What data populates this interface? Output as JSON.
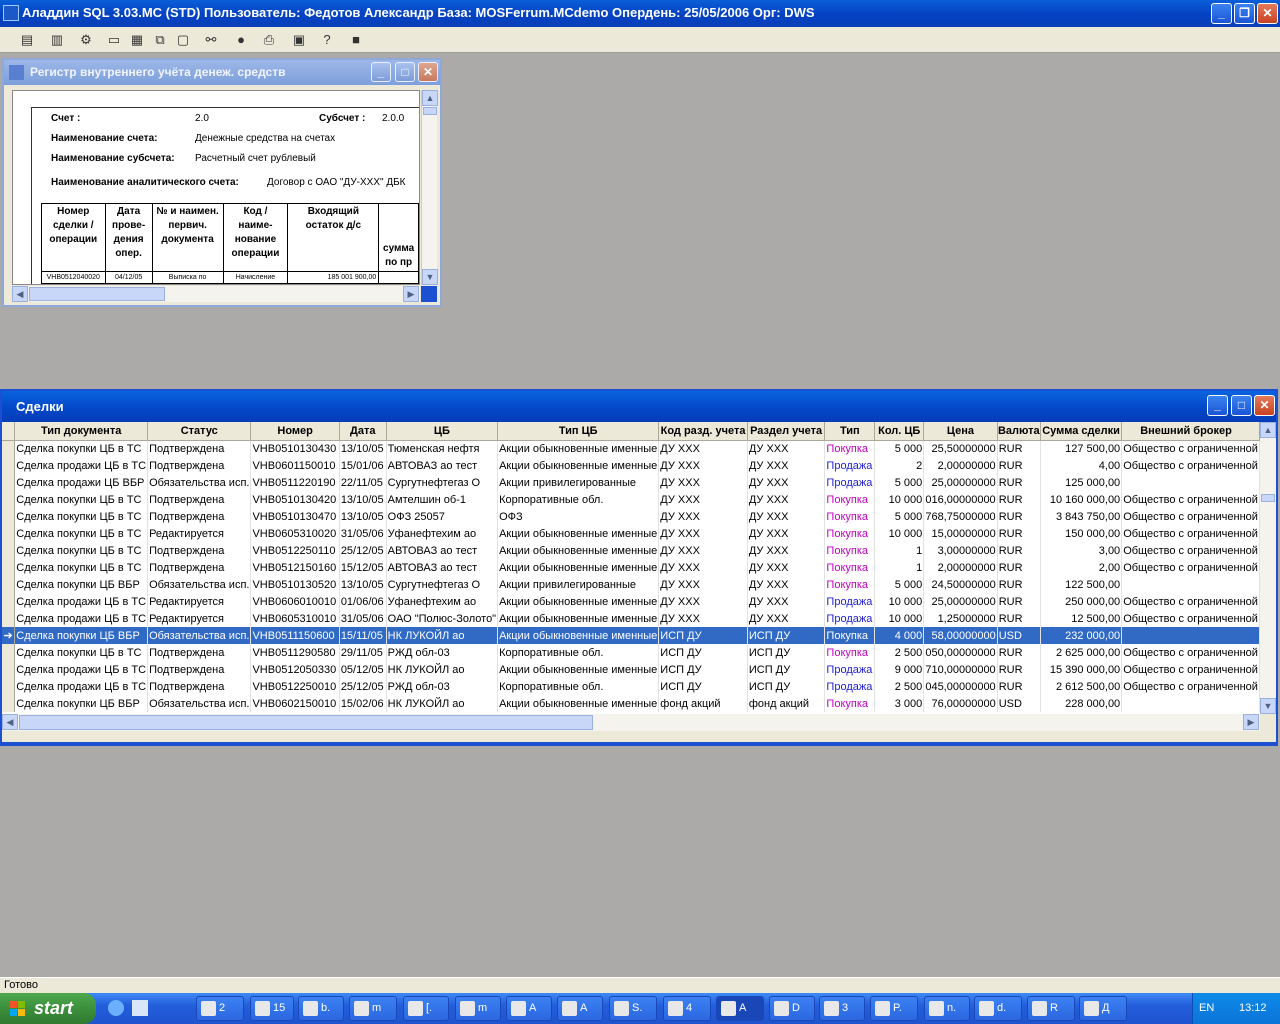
{
  "app": {
    "title": "Аладдин SQL 3.03.MC (STD)  Пользователь: Федотов Александр База: MOSFerrum.MCdemo Опердень: 25/05/2006 Орг: DWS"
  },
  "toolbar": {
    "icons": [
      "report-icon",
      "database-icon",
      "settings-icon",
      "window-icon",
      "tile-icon",
      "cascade-icon",
      "blank-icon",
      "binoculars-icon",
      "stop-icon",
      "print-icon",
      "export-icon",
      "help-icon",
      "exit-icon"
    ]
  },
  "register_window": {
    "title": "Регистр внутреннего учёта денеж. средств",
    "account_label": "Счет :",
    "account_value": "2.0",
    "subaccount_label": "Субсчет :",
    "subaccount_value": "2.0.0",
    "account_name_label": "Наименование счета:",
    "account_name_value": "Денежные средства на счетах",
    "subaccount_name_label": "Наименование субсчета:",
    "subaccount_name_value": "Расчетный счет рублевый",
    "analytic_label": "Наименование аналитического счета:",
    "analytic_value": "Договор с ОАО \"ДУ-XXX\" ДБК",
    "table_headers": [
      "Номер сделки / операции",
      "Дата прове- дения опер.",
      "№ и наимен. первич. документа",
      "Код / наиме- нование операции",
      "Входящий остаток д/с",
      "сумма по пр"
    ],
    "table_row": [
      "VHB0512040020",
      "04/12/05",
      "Выписка по",
      "Начисление",
      "185 001 900,00",
      ""
    ]
  },
  "deals_window": {
    "title": "Сделки",
    "columns": [
      "Тип документа",
      "Статус",
      "Номер",
      "Дата",
      "ЦБ",
      "Тип ЦБ",
      "Код разд. учета",
      "Раздел учета",
      "Тип",
      "Кол. ЦБ",
      "Цена",
      "Валюта",
      "Сумма сделки",
      "Внешний брокер"
    ],
    "rows": [
      {
        "doc": "Сделка покупки ЦБ в ТС",
        "status": "Подтверждена",
        "num": "VHB0510130430",
        "date": "13/10/05",
        "sec": "Тюменская нефтя",
        "sec_type": "Акции обыкновенные именные",
        "code": "ДУ XXX",
        "section": "ДУ XXX",
        "type": "Покупка",
        "qty": "5 000",
        "price": "25,50000000",
        "cur": "RUR",
        "sum": "127 500,00",
        "broker": "Общество с ограниченной",
        "kind": "buy",
        "selected": false
      },
      {
        "doc": "Сделка продажи ЦБ в ТС",
        "status": "Подтверждена",
        "num": "VHB0601150010",
        "date": "15/01/06",
        "sec": "АВТОВАЗ ао тест",
        "sec_type": "Акции обыкновенные именные",
        "code": "ДУ XXX",
        "section": "ДУ XXX",
        "type": "Продажа",
        "qty": "2",
        "price": "2,00000000",
        "cur": "RUR",
        "sum": "4,00",
        "broker": "Общество с ограниченной",
        "kind": "sell",
        "selected": false
      },
      {
        "doc": "Сделка продажи ЦБ ВБР",
        "status": "Обязательства исп.",
        "num": "VHB0511220190",
        "date": "22/11/05",
        "sec": "Сургутнефтегаз О",
        "sec_type": "Акции привилегированные",
        "code": "ДУ XXX",
        "section": "ДУ XXX",
        "type": "Продажа",
        "qty": "5 000",
        "price": "25,00000000",
        "cur": "RUR",
        "sum": "125 000,00",
        "broker": "",
        "kind": "sell",
        "selected": false
      },
      {
        "doc": "Сделка покупки ЦБ в ТС",
        "status": "Подтверждена",
        "num": "VHB0510130420",
        "date": "13/10/05",
        "sec": "Амтелшин об-1",
        "sec_type": "Корпоративные обл.",
        "code": "ДУ XXX",
        "section": "ДУ XXX",
        "type": "Покупка",
        "qty": "10 000",
        "price": "016,00000000",
        "cur": "RUR",
        "sum": "10 160 000,00",
        "broker": "Общество с ограниченной",
        "kind": "buy",
        "selected": false
      },
      {
        "doc": "Сделка покупки ЦБ в ТС",
        "status": "Подтверждена",
        "num": "VHB0510130470",
        "date": "13/10/05",
        "sec": "ОФЗ 25057",
        "sec_type": "ОФЗ",
        "code": "ДУ XXX",
        "section": "ДУ XXX",
        "type": "Покупка",
        "qty": "5 000",
        "price": "768,75000000",
        "cur": "RUR",
        "sum": "3 843 750,00",
        "broker": "Общество с ограниченной",
        "kind": "buy",
        "selected": false
      },
      {
        "doc": "Сделка покупки ЦБ в ТС",
        "status": "Редактируется",
        "num": "VHB0605310020",
        "date": "31/05/06",
        "sec": "Уфанефтехим ао",
        "sec_type": "Акции обыкновенные именные",
        "code": "ДУ XXX",
        "section": "ДУ XXX",
        "type": "Покупка",
        "qty": "10 000",
        "price": "15,00000000",
        "cur": "RUR",
        "sum": "150 000,00",
        "broker": "Общество с ограниченной",
        "kind": "buy",
        "selected": false
      },
      {
        "doc": "Сделка покупки ЦБ в ТС",
        "status": "Подтверждена",
        "num": "VHB0512250110",
        "date": "25/12/05",
        "sec": "АВТОВАЗ ао тест",
        "sec_type": "Акции обыкновенные именные",
        "code": "ДУ XXX",
        "section": "ДУ XXX",
        "type": "Покупка",
        "qty": "1",
        "price": "3,00000000",
        "cur": "RUR",
        "sum": "3,00",
        "broker": "Общество с ограниченной",
        "kind": "buy",
        "selected": false
      },
      {
        "doc": "Сделка покупки ЦБ в ТС",
        "status": "Подтверждена",
        "num": "VHB0512150160",
        "date": "15/12/05",
        "sec": "АВТОВАЗ ао тест",
        "sec_type": "Акции обыкновенные именные",
        "code": "ДУ XXX",
        "section": "ДУ XXX",
        "type": "Покупка",
        "qty": "1",
        "price": "2,00000000",
        "cur": "RUR",
        "sum": "2,00",
        "broker": "Общество с ограниченной",
        "kind": "buy",
        "selected": false
      },
      {
        "doc": "Сделка покупки ЦБ ВБР",
        "status": "Обязательства исп.",
        "num": "VHB0510130520",
        "date": "13/10/05",
        "sec": "Сургутнефтегаз О",
        "sec_type": "Акции привилегированные",
        "code": "ДУ XXX",
        "section": "ДУ XXX",
        "type": "Покупка",
        "qty": "5 000",
        "price": "24,50000000",
        "cur": "RUR",
        "sum": "122 500,00",
        "broker": "",
        "kind": "buy",
        "selected": false
      },
      {
        "doc": "Сделка продажи ЦБ в ТС",
        "status": "Редактируется",
        "num": "VHB0606010010",
        "date": "01/06/06",
        "sec": "Уфанефтехим ао",
        "sec_type": "Акции обыкновенные именные",
        "code": "ДУ XXX",
        "section": "ДУ XXX",
        "type": "Продажа",
        "qty": "10 000",
        "price": "25,00000000",
        "cur": "RUR",
        "sum": "250 000,00",
        "broker": "Общество с ограниченной",
        "kind": "sell",
        "selected": false
      },
      {
        "doc": "Сделка продажи ЦБ в ТС",
        "status": "Редактируется",
        "num": "VHB0605310010",
        "date": "31/05/06",
        "sec": "ОАО \"Полюс-Золото\"",
        "sec_type": "Акции обыкновенные именные",
        "code": "ДУ XXX",
        "section": "ДУ XXX",
        "type": "Продажа",
        "qty": "10 000",
        "price": "1,25000000",
        "cur": "RUR",
        "sum": "12 500,00",
        "broker": "Общество с ограниченной",
        "kind": "sell",
        "selected": false
      },
      {
        "doc": "Сделка покупки ЦБ ВБР",
        "status": "Обязательства исп.",
        "num": "VHB0511150600",
        "date": "15/11/05",
        "sec": "НК ЛУКОЙЛ  ао",
        "sec_type": "Акции обыкновенные именные",
        "code": "ИСП ДУ",
        "section": "ИСП ДУ",
        "type": "Покупка",
        "qty": "4 000",
        "price": "58,00000000",
        "cur": "USD",
        "sum": "232 000,00",
        "broker": "",
        "kind": "buy",
        "selected": true
      },
      {
        "doc": "Сделка покупки ЦБ в ТС",
        "status": "Подтверждена",
        "num": "VHB0511290580",
        "date": "29/11/05",
        "sec": "РЖД обл-03",
        "sec_type": "Корпоративные обл.",
        "code": "ИСП ДУ",
        "section": "ИСП ДУ",
        "type": "Покупка",
        "qty": "2 500",
        "price": "050,00000000",
        "cur": "RUR",
        "sum": "2 625 000,00",
        "broker": "Общество с ограниченной",
        "kind": "buy",
        "selected": false
      },
      {
        "doc": "Сделка продажи ЦБ в ТС",
        "status": "Подтверждена",
        "num": "VHB0512050330",
        "date": "05/12/05",
        "sec": "НК ЛУКОЙЛ  ао",
        "sec_type": "Акции обыкновенные именные",
        "code": "ИСП ДУ",
        "section": "ИСП ДУ",
        "type": "Продажа",
        "qty": "9 000",
        "price": "710,00000000",
        "cur": "RUR",
        "sum": "15 390 000,00",
        "broker": "Общество с ограниченной",
        "kind": "sell",
        "selected": false
      },
      {
        "doc": "Сделка продажи ЦБ в ТС",
        "status": "Подтверждена",
        "num": "VHB0512250010",
        "date": "25/12/05",
        "sec": "РЖД обл-03",
        "sec_type": "Корпоративные обл.",
        "code": "ИСП ДУ",
        "section": "ИСП ДУ",
        "type": "Продажа",
        "qty": "2 500",
        "price": "045,00000000",
        "cur": "RUR",
        "sum": "2 612 500,00",
        "broker": "Общество с ограниченной",
        "kind": "sell",
        "selected": false
      },
      {
        "doc": "Сделка покупки ЦБ ВБР",
        "status": "Обязательства исп.",
        "num": "VHB0602150010",
        "date": "15/02/06",
        "sec": "НК ЛУКОЙЛ  ао",
        "sec_type": "Акции обыкновенные именные",
        "code": "фонд акций",
        "section": "фонд акций",
        "type": "Покупка",
        "qty": "3 000",
        "price": "76,00000000",
        "cur": "USD",
        "sum": "228 000,00",
        "broker": "",
        "kind": "buy",
        "selected": false
      }
    ]
  },
  "status_bar": {
    "text": "Готово"
  },
  "taskbar": {
    "start_label": "start",
    "buttons": [
      "2",
      "15",
      "b.",
      "m",
      "[.",
      "m",
      "A",
      "A",
      "S.",
      "4",
      "A",
      "D",
      "3",
      "P.",
      "n.",
      "d.",
      "R",
      "Д"
    ],
    "lang": "EN",
    "clock": "13:12"
  },
  "colors": {
    "title_active": "#0a5fd8",
    "selection": "#316ac5",
    "buy": "#c000c0",
    "sell": "#2020d0"
  }
}
